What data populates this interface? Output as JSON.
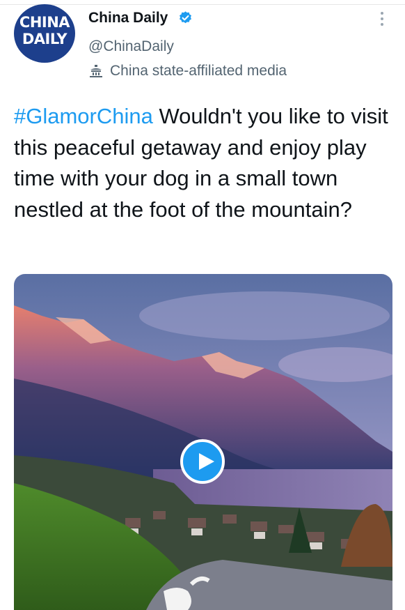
{
  "account": {
    "avatar_line1": "CHINA",
    "avatar_line2": "DAILY",
    "name": "China Daily",
    "handle": "@ChinaDaily",
    "label": "China state-affiliated media"
  },
  "tweet": {
    "hashtag": "#GlamorChina",
    "text": " Wouldn't you like to visit this peaceful getaway and enjoy play time with your dog in a small town nestled at the foot of the mountain?"
  },
  "colors": {
    "link": "#1d9bf0",
    "verified": "#1d9bf0",
    "avatar_bg": "#1d3f8c",
    "secondary_text": "#536471"
  },
  "icons": [
    "verified-badge-icon",
    "state-media-icon",
    "more-options-icon",
    "play-icon"
  ]
}
